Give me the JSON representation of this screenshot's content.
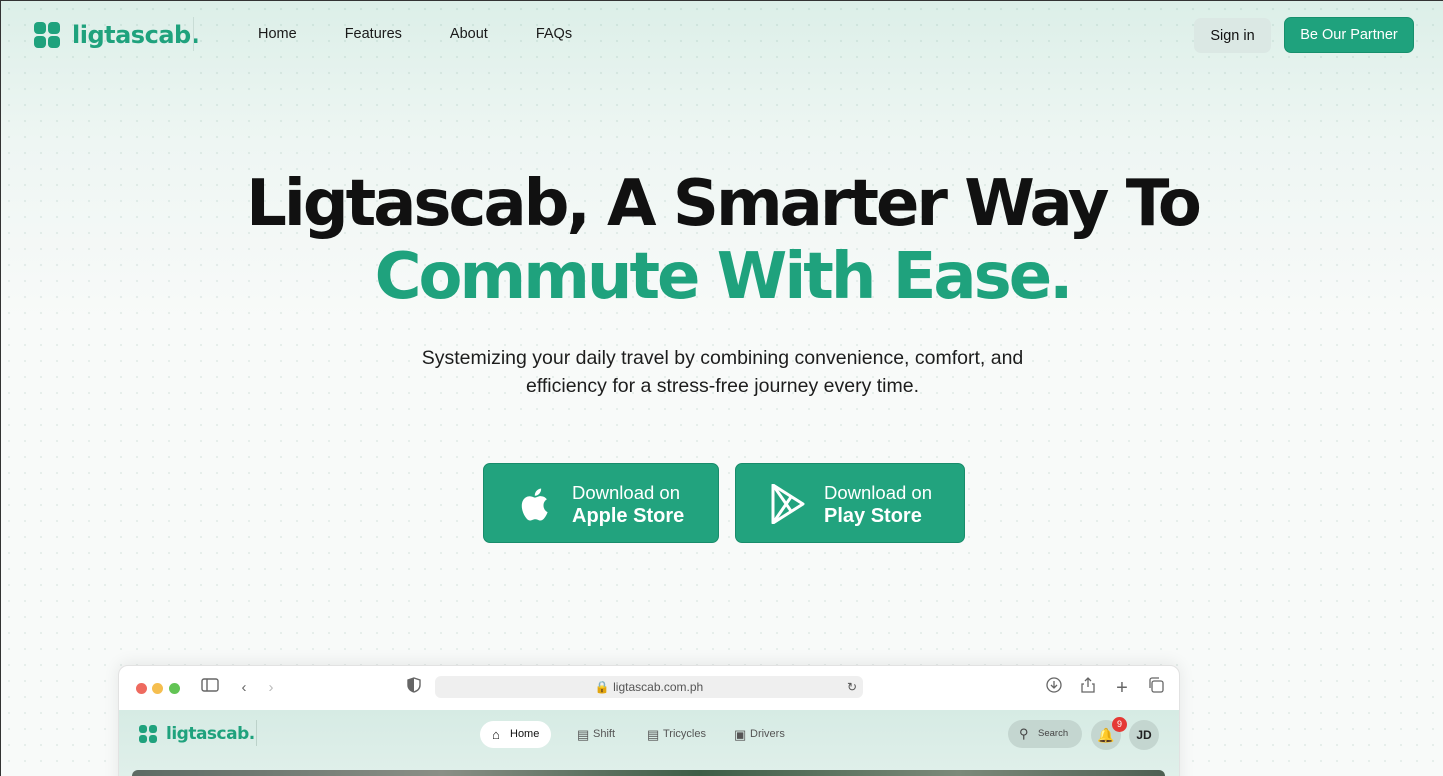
{
  "nav": {
    "brand": "ligtascab.",
    "links": [
      "Home",
      "Features",
      "About",
      "FAQs"
    ],
    "signin_label": "Sign in",
    "partner_label": "Be Our Partner"
  },
  "hero": {
    "title_line1": "Ligtascab, A Smarter Way To",
    "title_line2": "Commute With Ease.",
    "subtitle_line1": "Systemizing your daily travel by combining convenience, comfort, and",
    "subtitle_line2": "efficiency for a stress-free journey every time."
  },
  "downloads": {
    "apple": {
      "small": "Download on",
      "big": "Apple Store",
      "icon": "apple-icon"
    },
    "play": {
      "small": "Download on",
      "big": "Play Store",
      "icon": "play-store-icon"
    }
  },
  "browser_preview": {
    "url": "ligtascab.com.ph",
    "brand": "ligtascab.",
    "tabs": [
      {
        "label": "Home",
        "icon": "home-icon",
        "active": true
      },
      {
        "label": "Shift",
        "icon": "list-icon",
        "active": false
      },
      {
        "label": "Tricycles",
        "icon": "vehicle-icon",
        "active": false
      },
      {
        "label": "Drivers",
        "icon": "id-card-icon",
        "active": false
      }
    ],
    "search_label": "Search",
    "notification_count": "9",
    "avatar_initials": "JD"
  },
  "colors": {
    "brand": "#1fa27d",
    "title": "#111111",
    "badge": "#e53935"
  }
}
